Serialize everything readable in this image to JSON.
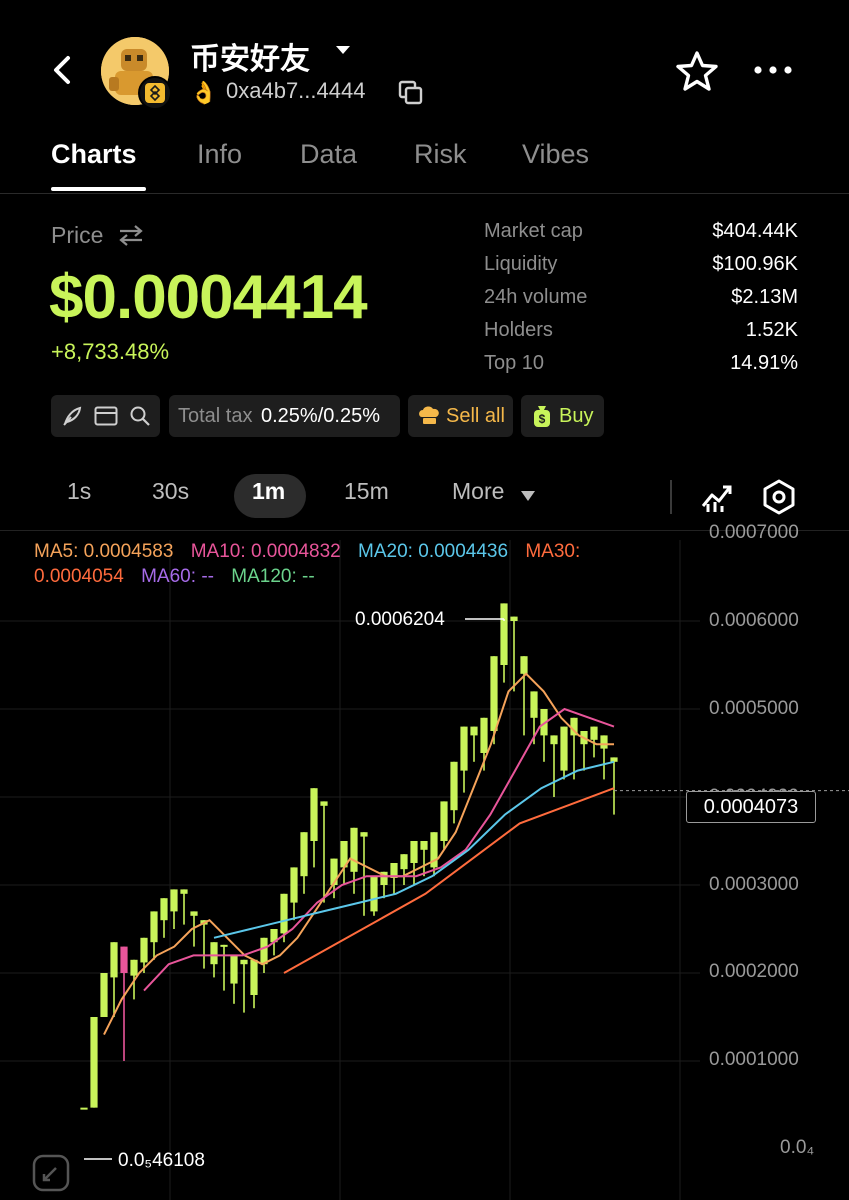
{
  "header": {
    "token_name": "币安好友",
    "address": "0xa4b7...4444",
    "hand_emoji": "👌"
  },
  "tabs": [
    {
      "label": "Charts",
      "active": true
    },
    {
      "label": "Info"
    },
    {
      "label": "Data"
    },
    {
      "label": "Risk"
    },
    {
      "label": "Vibes"
    }
  ],
  "price": {
    "label": "Price",
    "value": "$0.0004414",
    "change": "+8,733.48%"
  },
  "stats": [
    {
      "label": "Market cap",
      "value": "$404.44K"
    },
    {
      "label": "Liquidity",
      "value": "$100.96K"
    },
    {
      "label": "24h volume",
      "value": "$2.13M"
    },
    {
      "label": "Holders",
      "value": "1.52K"
    },
    {
      "label": "Top 10",
      "value": "14.91%"
    }
  ],
  "toolbar": {
    "tax_label": "Total tax",
    "tax_value": "0.25%/0.25%",
    "sell_label": "Sell all",
    "buy_label": "Buy"
  },
  "timeframes": {
    "items": [
      "1s",
      "30s",
      "1m",
      "15m"
    ],
    "active": "1m",
    "more_label": "More"
  },
  "ma": {
    "ma5_label": "MA5: ",
    "ma5_value": "0.0004583",
    "ma10_label": "MA10: ",
    "ma10_value": "0.0004832",
    "ma20_label": "MA20: ",
    "ma20_value": "0.0004436",
    "ma30_label": "MA30:",
    "ma30_value": "0.0004054",
    "ma60_label": "MA60: ",
    "ma60_value": "--",
    "ma120_label": "MA120: ",
    "ma120_value": "--"
  },
  "chart_data": {
    "type": "candlestick",
    "y_axis_ticks": [
      "0.0007000",
      "0.0006000",
      "0.0005000",
      "0.0004000",
      "0.0003000",
      "0.0002000",
      "0.0001000",
      "0.0₄"
    ],
    "last_price": "0.0004073",
    "high_label": "0.0006204",
    "low_label": "0.0₅46108",
    "ylim": [
      0,
      0.0007
    ],
    "up_color": "#c8f45a",
    "down_color": "#e8559a",
    "candles": [
      [
        4.7e-05,
        4.7e-05,
        4.7e-05,
        4.7e-05
      ],
      [
        4.7e-05,
        0.00015,
        4.7e-05,
        0.00015
      ],
      [
        0.00015,
        0.0002,
        0.00015,
        0.000195
      ],
      [
        0.000195,
        0.000235,
        0.00015,
        0.00023
      ],
      [
        0.00023,
        0.0002,
        0.0001,
        0.000197
      ],
      [
        0.000197,
        0.000215,
        0.00017,
        0.000212
      ],
      [
        0.000212,
        0.00024,
        0.0002,
        0.000235
      ],
      [
        0.000235,
        0.00027,
        0.000215,
        0.00026
      ],
      [
        0.00026,
        0.000285,
        0.00024,
        0.00027
      ],
      [
        0.00027,
        0.000295,
        0.00025,
        0.00029
      ],
      [
        0.00029,
        0.000295,
        0.000255,
        0.000265
      ],
      [
        0.000265,
        0.00027,
        0.00023,
        0.000255
      ],
      [
        0.000255,
        0.00026,
        0.000205,
        0.00021
      ],
      [
        0.00021,
        0.000235,
        0.000195,
        0.00023
      ],
      [
        0.00023,
        0.000232,
        0.00018,
        0.000188
      ],
      [
        0.000188,
        0.00022,
        0.000165,
        0.00021
      ],
      [
        0.00021,
        0.000215,
        0.000155,
        0.000175
      ],
      [
        0.000175,
        0.000215,
        0.00016,
        0.00021
      ],
      [
        0.00021,
        0.00024,
        0.0002,
        0.000235
      ],
      [
        0.000235,
        0.00025,
        0.00022,
        0.000245
      ],
      [
        0.000245,
        0.00029,
        0.000235,
        0.00028
      ],
      [
        0.00028,
        0.00032,
        0.00026,
        0.00031
      ],
      [
        0.00031,
        0.00036,
        0.00029,
        0.00035
      ],
      [
        0.00035,
        0.00041,
        0.00032,
        0.00039
      ],
      [
        0.00039,
        0.000395,
        0.00028,
        0.0003
      ],
      [
        0.0003,
        0.00033,
        0.000285,
        0.00032
      ],
      [
        0.00032,
        0.00035,
        0.0003,
        0.000315
      ],
      [
        0.000315,
        0.000365,
        0.00029,
        0.000355
      ],
      [
        0.000355,
        0.00036,
        0.000265,
        0.00027
      ],
      [
        0.00027,
        0.00031,
        0.000265,
        0.0003
      ],
      [
        0.0003,
        0.000315,
        0.000285,
        0.000308
      ],
      [
        0.000308,
        0.000325,
        0.00029,
        0.000318
      ],
      [
        0.000318,
        0.000335,
        0.0003,
        0.000325
      ],
      [
        0.000325,
        0.00035,
        0.0003,
        0.00034
      ],
      [
        0.00034,
        0.00035,
        0.00031,
        0.00032
      ],
      [
        0.00032,
        0.00036,
        0.00031,
        0.00035
      ],
      [
        0.00035,
        0.000395,
        0.00034,
        0.000385
      ],
      [
        0.000385,
        0.00044,
        0.00037,
        0.00043
      ],
      [
        0.00043,
        0.00048,
        0.000405,
        0.00047
      ],
      [
        0.00047,
        0.00048,
        0.00044,
        0.00045
      ],
      [
        0.00045,
        0.00049,
        0.00043,
        0.000475
      ],
      [
        0.000475,
        0.00056,
        0.00046,
        0.00055
      ],
      [
        0.00055,
        0.00062,
        0.00053,
        0.0006
      ],
      [
        0.0006,
        0.000605,
        0.00052,
        0.00054
      ],
      [
        0.00054,
        0.00056,
        0.00047,
        0.00049
      ],
      [
        0.00049,
        0.00052,
        0.00046,
        0.00047
      ],
      [
        0.00047,
        0.0005,
        0.00044,
        0.00046
      ],
      [
        0.00046,
        0.00047,
        0.0004,
        0.00043
      ],
      [
        0.00043,
        0.00048,
        0.00042,
        0.00047
      ],
      [
        0.00047,
        0.00049,
        0.00042,
        0.00046
      ],
      [
        0.00046,
        0.000475,
        0.00043,
        0.000465
      ],
      [
        0.000465,
        0.00048,
        0.000445,
        0.000455
      ],
      [
        0.000455,
        0.00047,
        0.00042,
        0.00044
      ],
      [
        0.00044,
        0.000445,
        0.00038,
        0.000407
      ]
    ],
    "ma5": [
      0.00013,
      0.00017,
      0.0002,
      0.00022,
      0.00023,
      0.00025,
      0.00026,
      0.00024,
      0.00022,
      0.00021,
      0.00022,
      0.00024,
      0.00027,
      0.0003,
      0.00033,
      0.00032,
      0.00031,
      0.00031,
      0.00032,
      0.00033,
      0.00036,
      0.00041,
      0.00046,
      0.00052,
      0.00054,
      0.00052,
      0.00049,
      0.00047,
      0.00046,
      0.00046
    ],
    "ma10": [
      0.00018,
      0.00021,
      0.00022,
      0.00022,
      0.00022,
      0.00023,
      0.00025,
      0.00028,
      0.0003,
      0.00031,
      0.00031,
      0.00031,
      0.00032,
      0.00034,
      0.00038,
      0.00043,
      0.00048,
      0.0005,
      0.00049,
      0.00048
    ],
    "ma20": [
      0.00024,
      0.00025,
      0.00026,
      0.00027,
      0.00028,
      0.00029,
      0.00031,
      0.00034,
      0.00038,
      0.00041,
      0.00043,
      0.00044
    ],
    "ma30": [
      0.0002,
      0.00023,
      0.00026,
      0.00029,
      0.00033,
      0.00037,
      0.00039,
      0.00041
    ]
  }
}
